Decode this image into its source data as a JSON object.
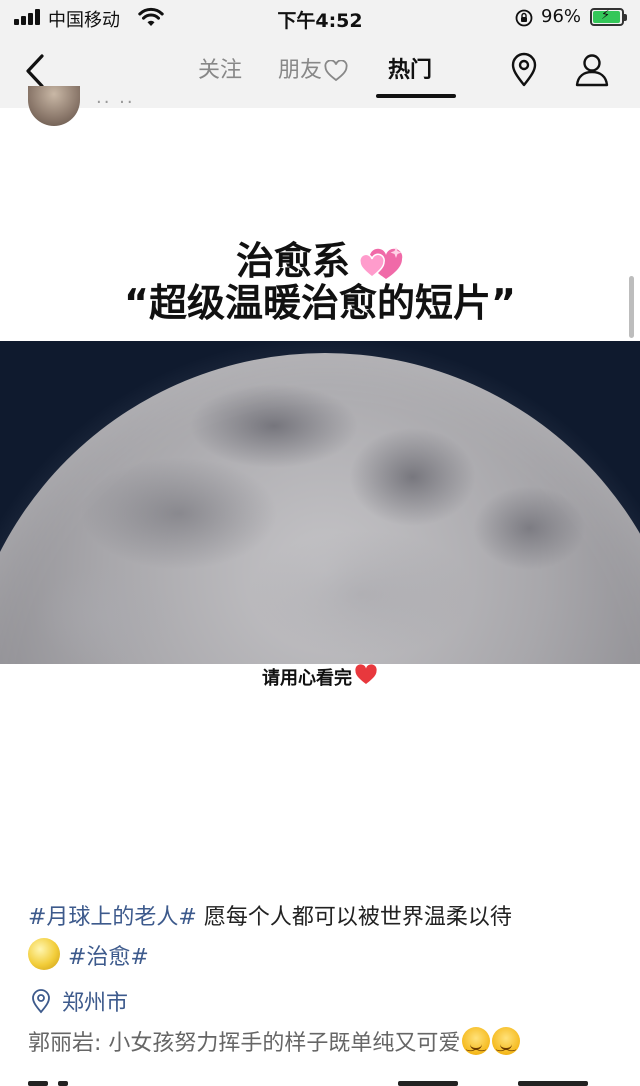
{
  "status_bar": {
    "carrier": "中国移动",
    "time": "下午4:52",
    "battery_percent": "96%",
    "battery_level": 0.96
  },
  "nav": {
    "tabs": [
      {
        "label": "关注",
        "active": false
      },
      {
        "label": "朋友",
        "active": false
      },
      {
        "label": "热门",
        "active": true
      }
    ],
    "icons": {
      "back": "chevron-left-icon",
      "location": "location-pin-icon",
      "profile": "person-icon"
    }
  },
  "post": {
    "video": {
      "title_line1": "治愈系",
      "title_line2": "“超级温暖治愈的短片”",
      "subtitle": "请用心看完"
    },
    "caption": {
      "hashtag1": "#月球上的老人#",
      "text": " 愿每个人都可以被世界温柔以待",
      "hashtag2": "#治愈#"
    },
    "location": "郑州市",
    "comment": {
      "author": "郭丽岩",
      "separator": ": ",
      "text": "小女孩努力挥手的样子既单纯又可爱"
    }
  },
  "colors": {
    "link": "#3d5a8c",
    "battery": "#34c759",
    "bar_background": "#f2f2f2"
  }
}
